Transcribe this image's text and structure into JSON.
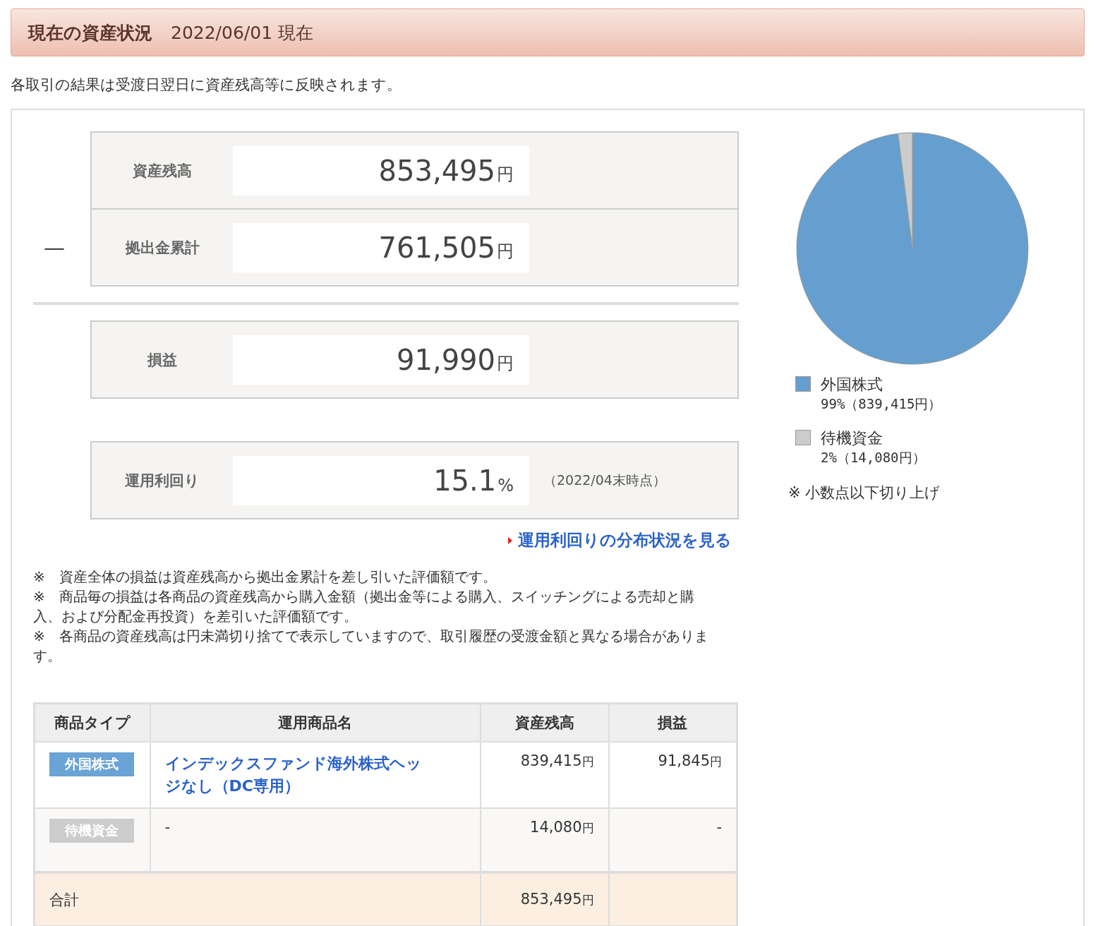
{
  "header": {
    "title": "現在の資産状況",
    "date": "2022/06/01 現在"
  },
  "notice": "各取引の結果は受渡日翌日に資産残高等に反映されます。",
  "summary": [
    [
      {
        "label": "資産残高",
        "value": "853,495",
        "unit": "円"
      },
      {
        "sign": "—",
        "label": "拠出金累計",
        "value": "761,505",
        "unit": "円"
      }
    ],
    [
      {
        "label": "損益",
        "value": "91,990",
        "unit": "円"
      }
    ],
    [
      {
        "label": "運用利回り",
        "value": "15.1",
        "unit": "%",
        "note": "（2022/04末時点）"
      }
    ]
  ],
  "link": "運用利回りの分布状況を見る",
  "notes": [
    "※　資産全体の損益は資産残高から拠出金累計を差し引いた評価額です。",
    "※　商品毎の損益は各商品の資産残高から購入金額（拠出金等による購入、スイッチングによる売却と購入、および分配金再投資）を差引いた評価額です。",
    "※　各商品の資産残高は円未満切り捨てで表示していますので、取引履歴の受渡金額と異なる場合があります。"
  ],
  "table": {
    "columns": [
      "商品タイプ",
      "運用商品名",
      "資産残高",
      "損益"
    ],
    "rows": [
      {
        "type": "外国株式",
        "color": "#6aa3d5",
        "product": {
          "kind": "link",
          "text": "インデックスファンド海外株式ヘッジなし（DC専用）"
        },
        "balance": "839,415",
        "balance_unit": "円",
        "profit": "91,845",
        "profit_unit": "円"
      },
      {
        "type": "待機資金",
        "color": "#cccccc",
        "product": {
          "kind": "plain",
          "text": "-"
        },
        "balance": "14,080",
        "balance_unit": "円",
        "profit": "-",
        "profit_unit": ""
      }
    ],
    "total": {
      "label": "合計",
      "balance": "853,495",
      "balance_unit": "円"
    }
  },
  "chart": {
    "chart_data": {
      "type": "pie",
      "categories": [
        "外国株式",
        "待機資金"
      ],
      "values": [
        99,
        2
      ]
    },
    "legend": [
      {
        "detail": "99%（839,415円）",
        "color": "#659fcf"
      },
      {
        "detail": "2%（14,080円）",
        "color": "#cccccc"
      }
    ],
    "footnote": "※ 小数点以下切り上げ"
  }
}
